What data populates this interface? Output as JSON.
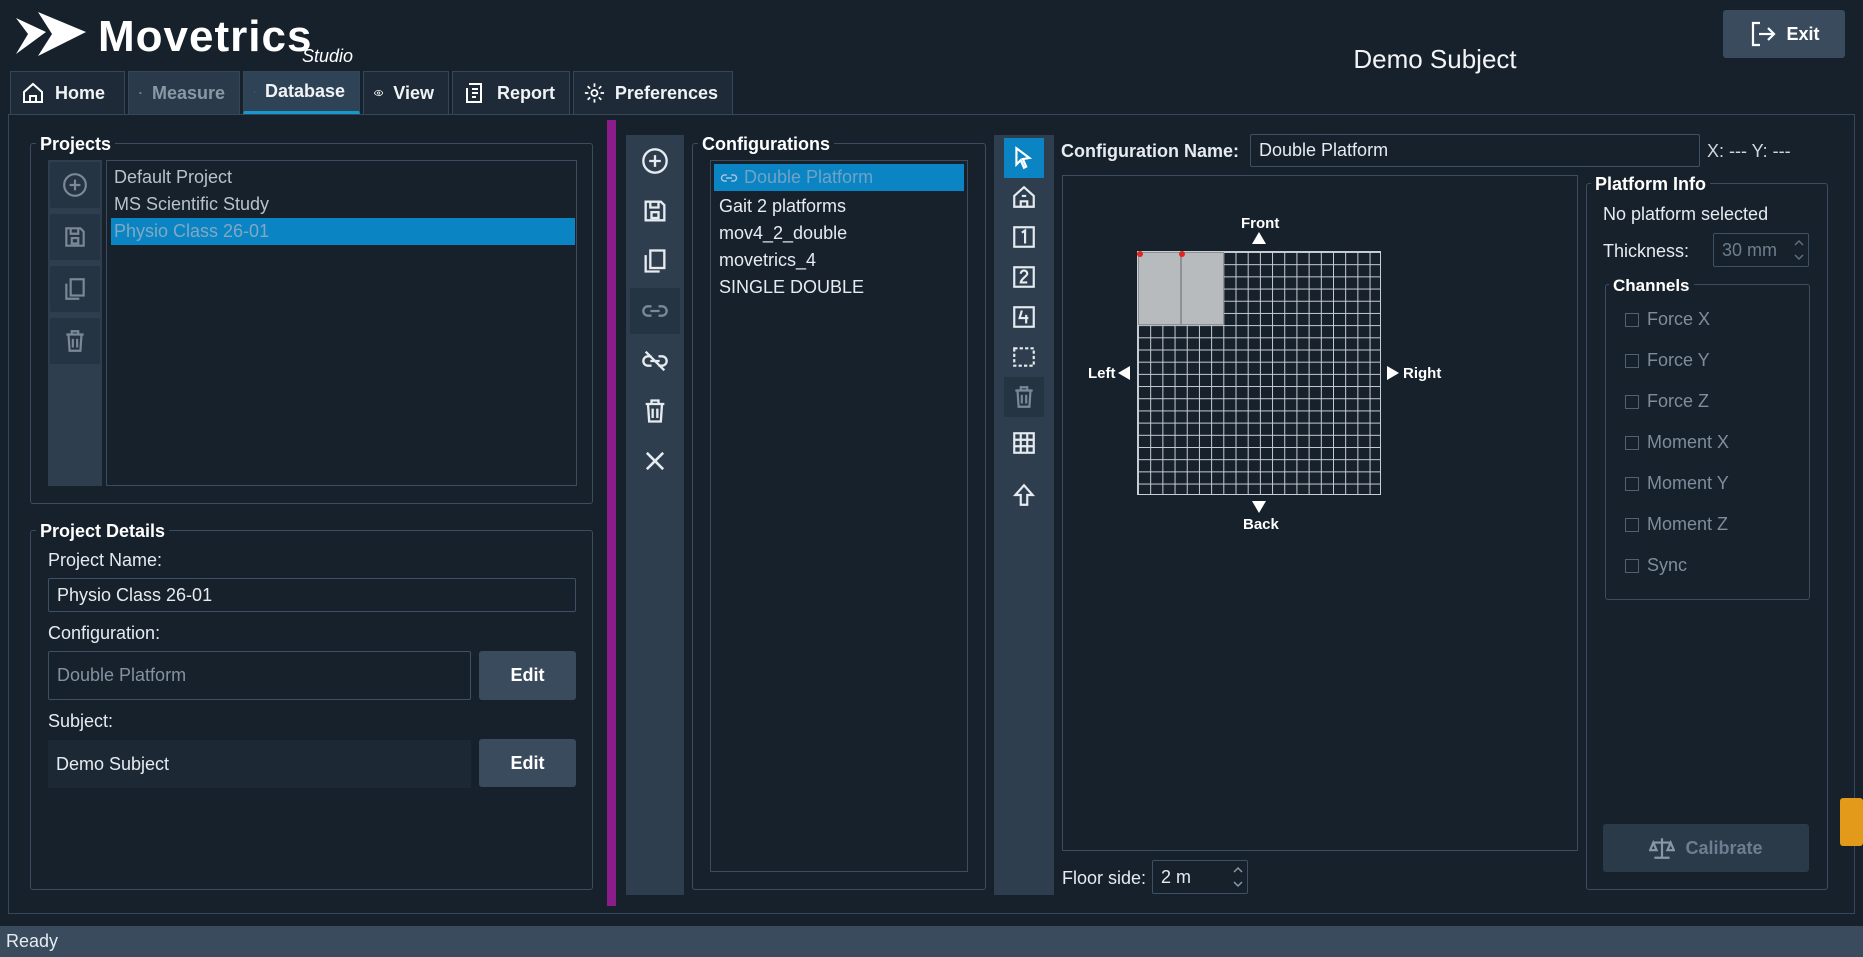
{
  "app": {
    "logo_text": "Movetrics",
    "logo_sub": "Studio",
    "subject_title": "Demo Subject",
    "exit_label": "Exit"
  },
  "tabs": [
    {
      "label": "Home",
      "icon": "home-icon"
    },
    {
      "label": "Measure",
      "icon": "pulse-icon"
    },
    {
      "label": "Database",
      "icon": "database-icon"
    },
    {
      "label": "View",
      "icon": "eye-icon"
    },
    {
      "label": "Report",
      "icon": "report-icon"
    },
    {
      "label": "Preferences",
      "icon": "gear-icon"
    }
  ],
  "projects": {
    "title": "Projects",
    "items": [
      "Default Project",
      "MS Scientific Study",
      "Physio Class 26-01"
    ],
    "selected": "Physio Class 26-01"
  },
  "project_details": {
    "title": "Project Details",
    "name_label": "Project Name:",
    "name_value": "Physio Class 26-01",
    "config_label": "Configuration:",
    "config_value": "Double Platform",
    "subject_label": "Subject:",
    "subject_value": "Demo Subject",
    "edit_label": "Edit"
  },
  "configurations": {
    "title": "Configurations",
    "items": [
      "Double Platform",
      "Gait 2 platforms",
      "mov4_2_double",
      "movetrics_4",
      "SINGLE DOUBLE"
    ],
    "selected": "Double Platform"
  },
  "editor": {
    "name_label": "Configuration Name:",
    "name_value": "Double Platform",
    "xy_readout": "X: --- Y: ---",
    "front": "Front",
    "back": "Back",
    "left": "Left",
    "right": "Right",
    "floor_label": "Floor side:",
    "floor_value": "2 m"
  },
  "platform_info": {
    "title": "Platform Info",
    "status": "No platform selected",
    "thickness_label": "Thickness:",
    "thickness_value": "30 mm",
    "channels_title": "Channels",
    "channels": [
      "Force X",
      "Force Y",
      "Force Z",
      "Moment X",
      "Moment Y",
      "Moment Z",
      "Sync"
    ],
    "calibrate_label": "Calibrate"
  },
  "status": {
    "text": "Ready"
  },
  "colors": {
    "accent": "#0b84c3",
    "splitter": "#8a1d8a",
    "background": "#17212c"
  }
}
